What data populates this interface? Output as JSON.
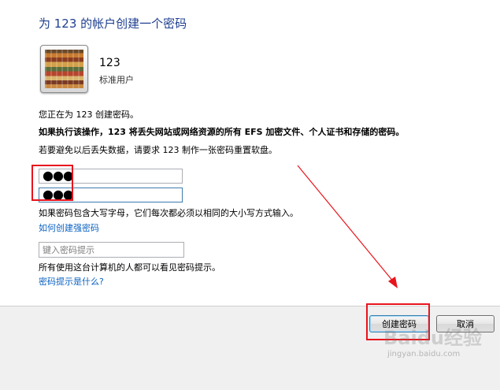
{
  "header": {
    "title": "为 123 的帐户创建一个密码"
  },
  "account": {
    "name": "123",
    "type": "标准用户"
  },
  "info": {
    "line1": "您正在为 123 创建密码。",
    "warning": "如果执行该操作，123 将丢失网站或网络资源的所有 EFS 加密文件、个人证书和存储的密码。",
    "line3": "若要避免以后丢失数据，请要求 123 制作一张密码重置软盘。"
  },
  "password": {
    "value_masked": "●●●"
  },
  "confirm_password": {
    "value_masked": "●●●"
  },
  "case_note": "如果密码包含大写字母，它们每次都必须以相同的大小写方式输入。",
  "strong_password_link": "如何创建强密码",
  "hint": {
    "placeholder": "键入密码提示",
    "value": ""
  },
  "hint_note": "所有使用这台计算机的人都可以看见密码提示。",
  "hint_link": "密码提示是什么?",
  "buttons": {
    "create": "创建密码",
    "cancel": "取消"
  },
  "watermark": {
    "logo": "Baidu经验",
    "url": "jingyan.baidu.com"
  },
  "colors": {
    "title": "#1e3f8f",
    "link": "#0b62c2",
    "annotation": "#e8141c"
  },
  "icons": {
    "avatar": "user-picture-icon"
  }
}
